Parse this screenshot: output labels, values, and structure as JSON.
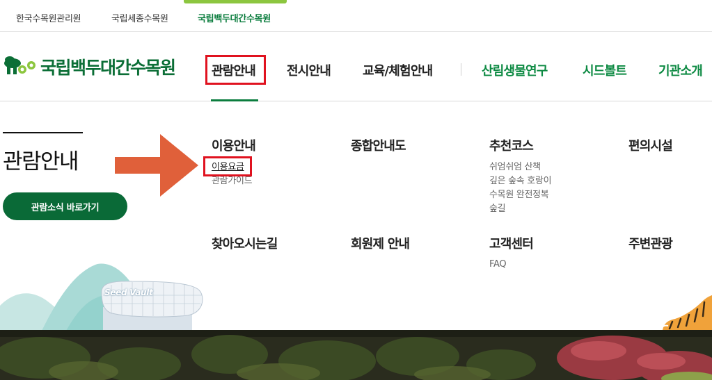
{
  "topbar": {
    "sites": [
      {
        "label": "한국수목원관리원"
      },
      {
        "label": "국립세종수목원"
      },
      {
        "label": "국립백두대간수목원"
      }
    ]
  },
  "header": {
    "logo_text": "국립백두대간수목원",
    "gnb": [
      {
        "label": "관람안내"
      },
      {
        "label": "전시안내"
      },
      {
        "label": "교육/체험안내"
      },
      {
        "label": "산림생물연구"
      },
      {
        "label": "시드볼트"
      },
      {
        "label": "기관소개"
      }
    ]
  },
  "side": {
    "title": "관람안내",
    "news_button": "관람소식 바로가기"
  },
  "menu": {
    "row1": [
      {
        "title": "이용안내",
        "items": [
          "이용요금",
          "관람가이드"
        ]
      },
      {
        "title": "종합안내도",
        "items": []
      },
      {
        "title": "추천코스",
        "items": [
          "쉬엄쉬엄 산책",
          "깊은 숲속 호랑이",
          "수목원 완전정복",
          "숲길"
        ]
      },
      {
        "title": "편의시설",
        "items": []
      }
    ],
    "row2": [
      {
        "title": "찾아오시는길",
        "items": []
      },
      {
        "title": "회원제 안내",
        "items": []
      },
      {
        "title": "고객센터",
        "items": [
          "FAQ"
        ]
      },
      {
        "title": "주변관광",
        "items": []
      }
    ]
  },
  "illustration": {
    "seed_vault_label": "Seed Vault"
  },
  "colors": {
    "brand_green": "#0b6e36",
    "accent_green": "#8cc63f",
    "highlight_red": "#e0121f",
    "arrow_orange": "#e0603a"
  }
}
